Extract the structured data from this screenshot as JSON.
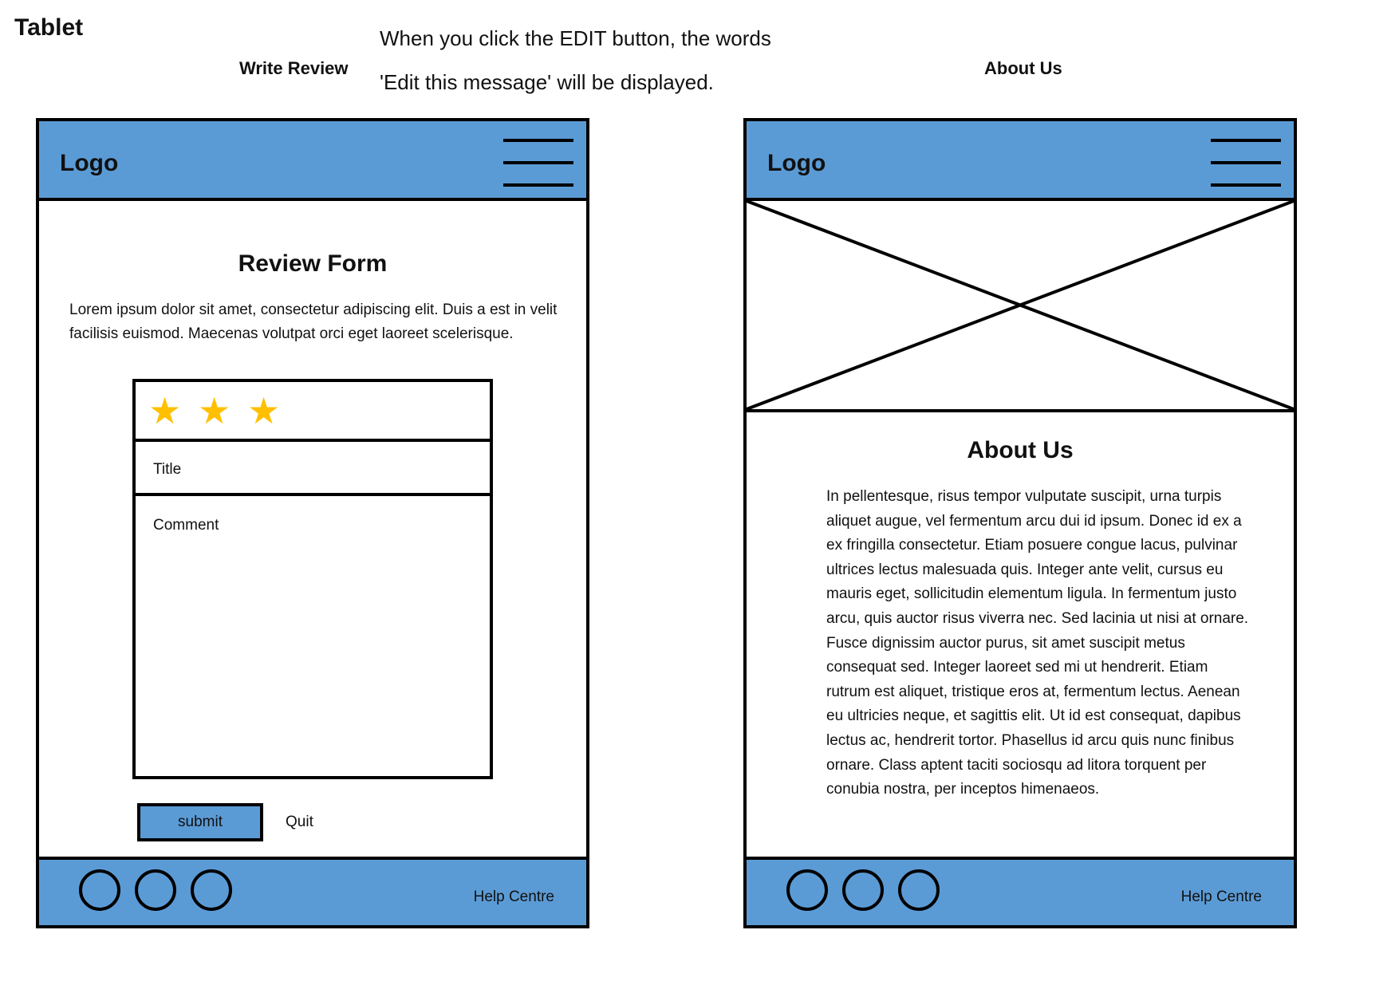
{
  "page": {
    "title": "Tablet",
    "note_line1": "When you click the EDIT button, the words",
    "note_line2": "'Edit this message' will be displayed."
  },
  "screens": {
    "left_label": "Write Review",
    "right_label": "About Us"
  },
  "header": {
    "logo": "Logo",
    "menu_icon": "hamburger-menu-icon"
  },
  "review": {
    "heading": "Review Form",
    "intro": "Lorem ipsum dolor sit amet, consectetur adipiscing elit. Duis a est in velit facilisis euismod. Maecenas volutpat orci eget laoreet scelerisque.",
    "stars": [
      "★",
      "★",
      "★"
    ],
    "title_placeholder": "Title",
    "comment_placeholder": "Comment",
    "submit_label": "submit",
    "quit_label": "Quit"
  },
  "about": {
    "image_placeholder": "image-placeholder-icon",
    "heading": "About Us",
    "body": "In pellentesque, risus tempor vulputate suscipit, urna turpis aliquet augue, vel fermentum arcu dui id ipsum. Donec id ex a ex fringilla consectetur. Etiam posuere congue lacus, pulvinar ultrices lectus malesuada quis. Integer ante velit, cursus eu mauris eget, sollicitudin elementum ligula. In fermentum justo arcu, quis auctor risus viverra nec. Sed lacinia ut nisi at ornare. Fusce dignissim auctor purus, sit amet suscipit metus consequat sed. Integer laoreet sed mi ut hendrerit. Etiam rutrum est aliquet, tristique eros at, fermentum lectus. Aenean eu ultricies neque, et sagittis elit. Ut id est consequat, dapibus lectus ac, hendrerit tortor. Phasellus id arcu quis nunc finibus ornare. Class aptent taciti sociosqu ad litora torquent per conubia nostra, per inceptos himenaeos."
  },
  "footer": {
    "social_icons": [
      "social-circle-icon",
      "social-circle-icon",
      "social-circle-icon"
    ],
    "help_label": "Help Centre"
  },
  "colors": {
    "accent": "#5b9bd5",
    "star": "#ffc000",
    "outline": "#000000"
  }
}
